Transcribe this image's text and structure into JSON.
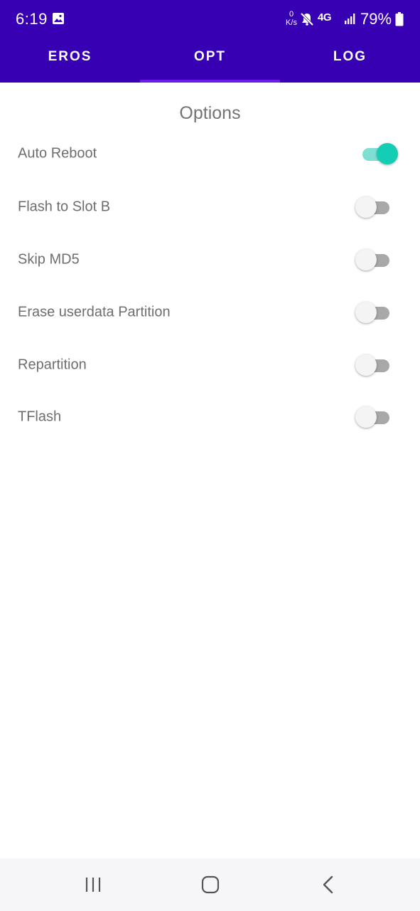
{
  "status_bar": {
    "time": "6:19",
    "net_speed_value": "0",
    "net_speed_unit": "K/s",
    "network_type": "4G",
    "battery": "79%"
  },
  "tabs": [
    {
      "label": "EROS",
      "selected": false
    },
    {
      "label": "OPT",
      "selected": true
    },
    {
      "label": "LOG",
      "selected": false
    }
  ],
  "colors": {
    "header": "#3700b3",
    "tab_indicator": "#6a1de8",
    "switch_on": "#13cdb5"
  },
  "options": {
    "title": "Options",
    "items": [
      {
        "label": "Auto Reboot",
        "checked": true
      },
      {
        "label": "Flash to Slot B",
        "checked": false
      },
      {
        "label": "Skip MD5",
        "checked": false
      },
      {
        "label": "Erase userdata Partition",
        "checked": false
      },
      {
        "label": "Repartition",
        "checked": false
      },
      {
        "label": "TFlash",
        "checked": false
      }
    ]
  },
  "navbar": {
    "recents": "recents-icon",
    "home": "home-icon",
    "back": "back-icon"
  }
}
